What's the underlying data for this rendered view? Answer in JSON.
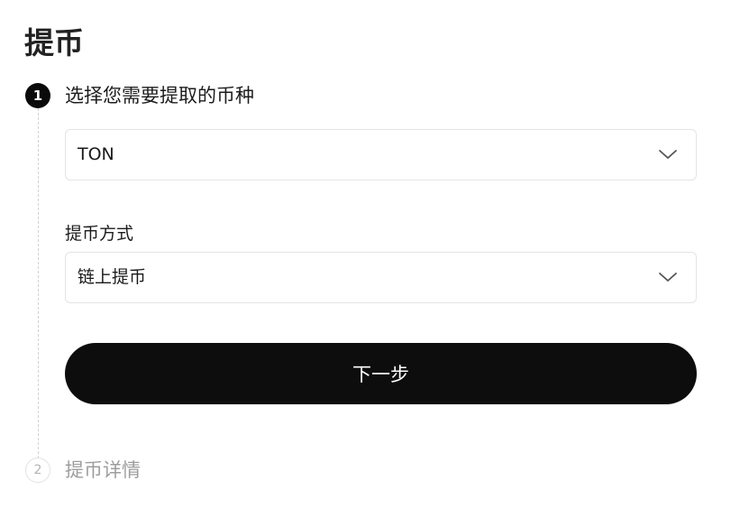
{
  "page": {
    "title": "提币"
  },
  "steps": [
    {
      "number": "1",
      "title": "选择您需要提取的币种",
      "state": "active"
    },
    {
      "number": "2",
      "title": "提币详情",
      "state": "inactive"
    }
  ],
  "coin_select": {
    "value": "TON",
    "icon": "chevron-down-icon"
  },
  "withdraw_method": {
    "label": "提币方式",
    "value": "链上提币",
    "icon": "chevron-down-icon"
  },
  "next_button": {
    "label": "下一步"
  },
  "colors": {
    "primary": "#0d0d0d",
    "border": "#e4e4e4",
    "muted_text": "#9d9d9d"
  }
}
